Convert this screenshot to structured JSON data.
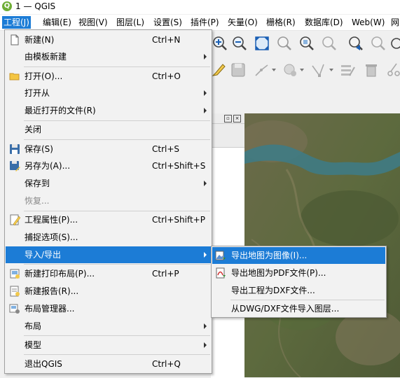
{
  "window": {
    "title": "1 — QGIS",
    "logo_letter": "Q"
  },
  "menubar": [
    "工程(J)",
    "编辑(E)",
    "视图(V)",
    "图层(L)",
    "设置(S)",
    "插件(P)",
    "矢量(O)",
    "栅格(R)",
    "数据库(D)",
    "Web(W)",
    "网"
  ],
  "project_menu": {
    "items": [
      {
        "label": "新建(N)",
        "shortcut": "Ctrl+N",
        "icon": "new-file-icon"
      },
      {
        "label": "由模板新建",
        "submenu": true
      },
      {
        "label": "打开(O)...",
        "shortcut": "Ctrl+O",
        "icon": "folder-open-icon"
      },
      {
        "label": "打开从",
        "submenu": true
      },
      {
        "label": "最近打开的文件(R)",
        "submenu": true
      },
      {
        "label": "关闭"
      },
      {
        "label": "保存(S)",
        "shortcut": "Ctrl+S",
        "icon": "save-icon"
      },
      {
        "label": "另存为(A)...",
        "shortcut": "Ctrl+Shift+S",
        "icon": "save-as-icon"
      },
      {
        "label": "保存到",
        "submenu": true
      },
      {
        "label": "恢复...",
        "disabled": true
      },
      {
        "label": "工程属性(P)...",
        "shortcut": "Ctrl+Shift+P",
        "icon": "project-properties-icon"
      },
      {
        "label": "捕捉选项(S)..."
      },
      {
        "label": "导入/导出",
        "submenu": true,
        "highlighted": true
      },
      {
        "label": "新建打印布局(P)...",
        "shortcut": "Ctrl+P",
        "icon": "new-print-layout-icon"
      },
      {
        "label": "新建报告(R)...",
        "icon": "new-report-icon"
      },
      {
        "label": "布局管理器...",
        "icon": "layout-manager-icon"
      },
      {
        "label": "布局",
        "submenu": true
      },
      {
        "label": "模型",
        "submenu": true
      },
      {
        "label": "退出QGIS",
        "shortcut": "Ctrl+Q"
      }
    ]
  },
  "import_export_submenu": {
    "items": [
      {
        "label": "导出地图为图像(I)...",
        "icon": "export-image-icon",
        "highlighted": true
      },
      {
        "label": "导出地图为PDF文件(P)...",
        "icon": "export-pdf-icon"
      },
      {
        "label": "导出工程为DXF文件..."
      },
      {
        "label": "从DWG/DXF文件导入图层..."
      }
    ]
  },
  "colors": {
    "highlight": "#1c7cd6",
    "menu_bg": "#f2f2f2",
    "logo_green": "#6fae36"
  }
}
